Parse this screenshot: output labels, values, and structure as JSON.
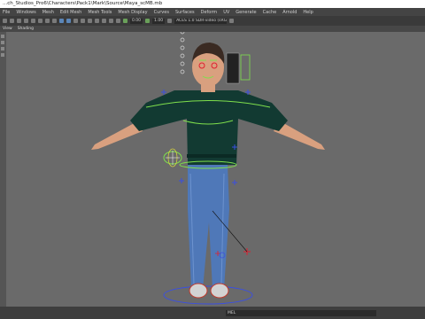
{
  "window": {
    "title": "...ch_Studios_Pro6\\Characters\\Pack1\\Mark\\Source\\Maya_scMB.mb"
  },
  "menubar": {
    "items": [
      "File",
      "Windows",
      "Mesh",
      "Edit Mesh",
      "Mesh Tools",
      "Mesh Display",
      "Curves",
      "Surfaces",
      "Deform",
      "UV",
      "Generate",
      "Cache",
      "Arnold",
      "Help"
    ]
  },
  "toolbar": {
    "field_a": "0.00",
    "field_b": "1.00",
    "field_c": "ACES 1.0 SDR-video (sRGB)"
  },
  "panel_menu": {
    "items": [
      "View",
      "Shading"
    ]
  },
  "statusbar": {
    "mel_label": "MEL"
  },
  "colors": {
    "viewport_bg": "#6a6a6a",
    "sweater": "#123a32",
    "jeans": "#4f78b8",
    "skin": "#d9a07f",
    "rig_green": "#7fe04c",
    "rig_blue": "#3b4fe0",
    "rig_red": "#e01f2e"
  }
}
